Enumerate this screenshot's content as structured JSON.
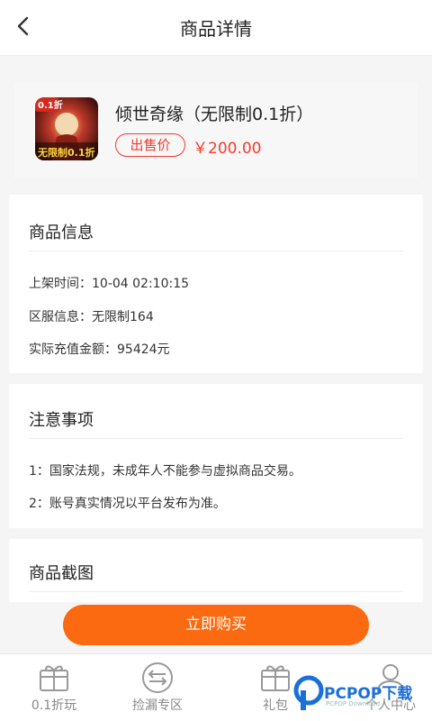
{
  "header": {
    "title": "商品详情"
  },
  "product": {
    "name": "倾世奇缘（无限制0.1折）",
    "badge": "出售价",
    "price": "￥200.00",
    "icon_badge": "0.1折",
    "icon_caption": "无限制0.1折"
  },
  "info": {
    "title": "商品信息",
    "rows": [
      {
        "label": "上架时间：",
        "value": "10-04 02:10:15"
      },
      {
        "label": "区服信息：",
        "value": "无限制164"
      },
      {
        "label": "实际充值金额：",
        "value": "95424元"
      }
    ]
  },
  "notes": {
    "title": "注意事项",
    "items": [
      "1：国家法规，未成年人不能参与虚拟商品交易。",
      "2：账号真实情况以平台发布为准。"
    ]
  },
  "screenshots": {
    "title": "商品截图"
  },
  "buy_button": "立即购买",
  "tabs": [
    {
      "label": "0.1折玩",
      "icon": "gift-box-icon"
    },
    {
      "label": "捡漏专区",
      "icon": "exchange-arrows-icon"
    },
    {
      "label": "礼包",
      "icon": "gift-box-icon"
    },
    {
      "label": "个人中心",
      "icon": "user-icon"
    }
  ],
  "watermark": {
    "text": "PCPOP下载",
    "sub": "PCPOP Download"
  },
  "colors": {
    "accent": "#fb6a10",
    "price_red": "#f43b2e",
    "watermark_blue": "#1b6fd8"
  }
}
